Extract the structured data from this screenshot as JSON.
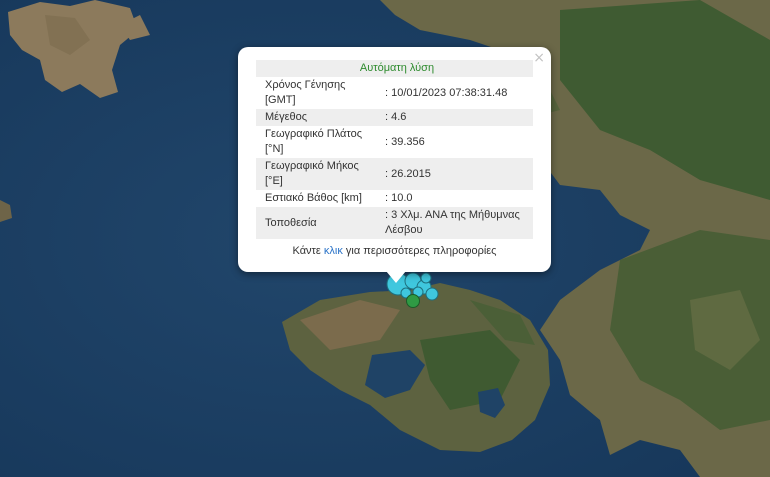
{
  "map": {
    "description_colors": {
      "sea": "#1b3f63",
      "land": "#6f6a4a",
      "forest": "#405b34",
      "marker_cyan": "#3fc7de",
      "marker_green": "#2f9a44"
    }
  },
  "popup": {
    "close_symbol": "×",
    "header": "Αυτόματη λύση",
    "rows": [
      {
        "label": "Χρόνος Γένησης [GMT]",
        "value": ": 10/01/2023 07:38:31.48"
      },
      {
        "label": "Μέγεθος",
        "value": ": 4.6"
      },
      {
        "label": "Γεωγραφικό Πλάτος [°N]",
        "value": ": 39.356"
      },
      {
        "label": "Γεωγραφικό Μήκος [°E]",
        "value": ": 26.2015"
      },
      {
        "label": "Εστιακό Βάθος [km]",
        "value": ": 10.0"
      },
      {
        "label": "Τοποθεσία",
        "value": ": 3 Χλμ. ΑΝΑ της Μήθυμνας Λέσβου"
      }
    ],
    "more_prefix": "Κάντε ",
    "more_link": "κλικ",
    "more_suffix": " για περισσότερες πληροφορίες"
  }
}
